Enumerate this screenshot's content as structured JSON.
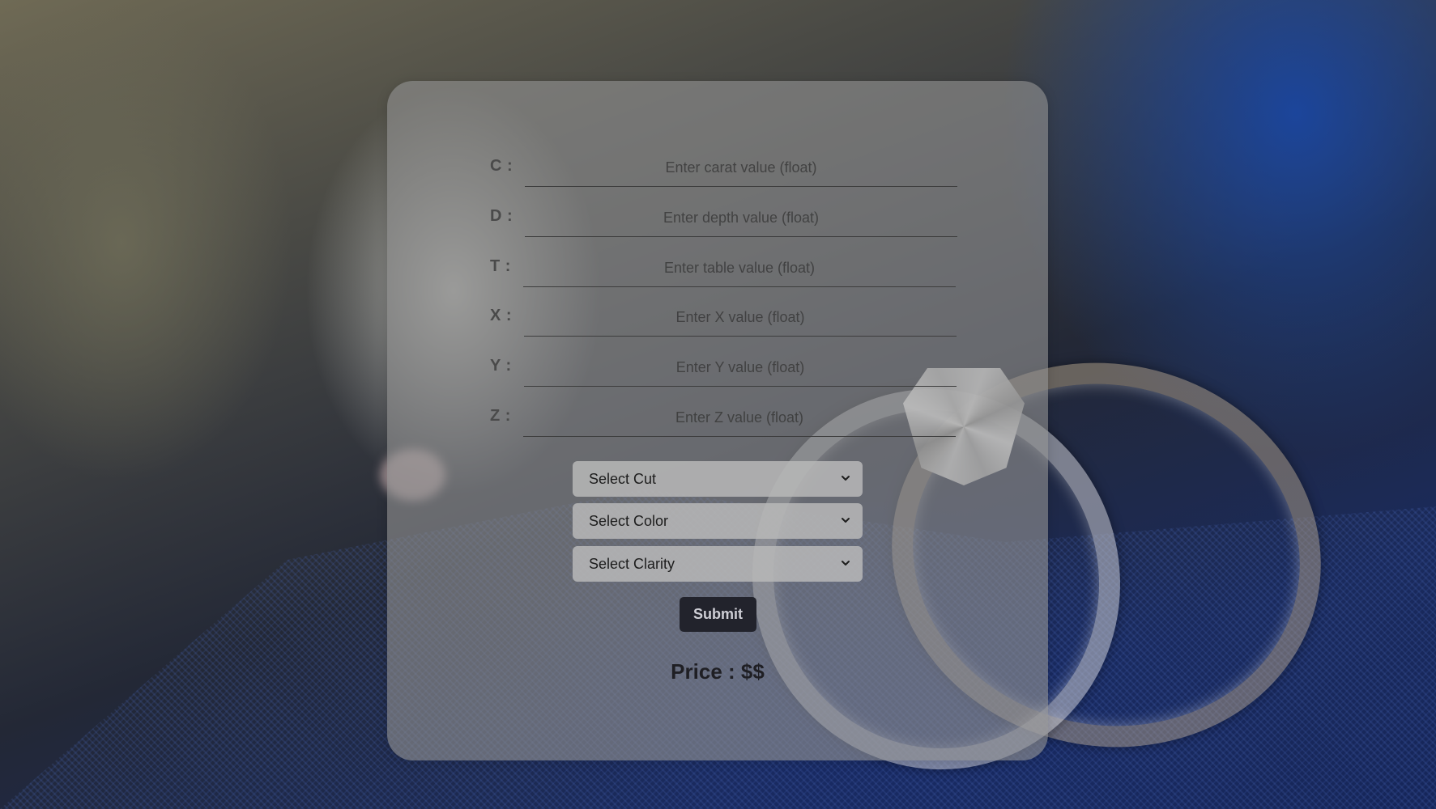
{
  "form": {
    "fields": [
      {
        "label": "C :",
        "placeholder": "Enter carat value (float)"
      },
      {
        "label": "D :",
        "placeholder": "Enter depth value (float)"
      },
      {
        "label": "T :",
        "placeholder": "Enter table value (float)"
      },
      {
        "label": "X :",
        "placeholder": "Enter X value (float)"
      },
      {
        "label": "Y :",
        "placeholder": "Enter Y value (float)"
      },
      {
        "label": "Z :",
        "placeholder": "Enter Z value (float)"
      }
    ],
    "selects": [
      {
        "selected": "Select Cut"
      },
      {
        "selected": "Select Color"
      },
      {
        "selected": "Select Clarity"
      }
    ],
    "submit_label": "Submit",
    "price_text": "Price : $$"
  },
  "icons": {
    "select_arrow": "chevron-down-icon"
  },
  "colors": {
    "card_bg": "#919191",
    "button_bg": "#22232c",
    "background_accent": "#1a46a0"
  }
}
